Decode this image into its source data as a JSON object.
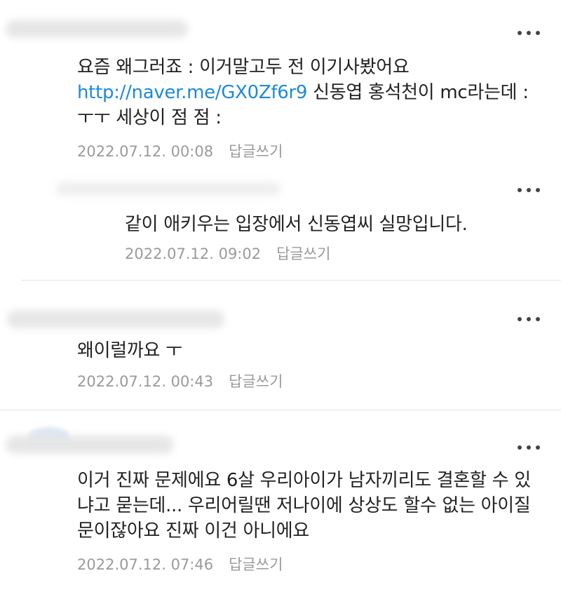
{
  "comments": [
    {
      "body_text": "요즘 왜그러죠 : 이거말고두 전 이기사봤어요 ",
      "link": "http://naver.me/GX0Zf6r9",
      "body_text_after": " 신동엽 홍석천이 mc라는데 : ㅜㅜ 세상이 점 점  :",
      "timestamp": "2022.07.12. 00:08",
      "reply_label": "답글쓰기"
    },
    {
      "body_text": "같이 애키우는 입장에서 신동엽씨 실망입니다.",
      "timestamp": "2022.07.12. 09:02",
      "reply_label": "답글쓰기",
      "is_reply": true
    },
    {
      "body_text": "왜이럴까요 ㅜ",
      "timestamp": "2022.07.12. 00:43",
      "reply_label": "답글쓰기"
    },
    {
      "body_text": "이거 진짜 문제에요 6살 우리아이가 남자끼리도 결혼할 수 있냐고 묻는데... 우리어릴땐 저나이에 상상도 할수 없는 아이질문이잖아요 진짜 이건 아니에요",
      "timestamp": "2022.07.12. 07:46",
      "reply_label": "답글쓰기"
    }
  ],
  "icons": {
    "more": "more-dots-icon"
  },
  "colors": {
    "link": "#1e8ad6",
    "meta": "#9a9a9a",
    "text": "#222222"
  }
}
